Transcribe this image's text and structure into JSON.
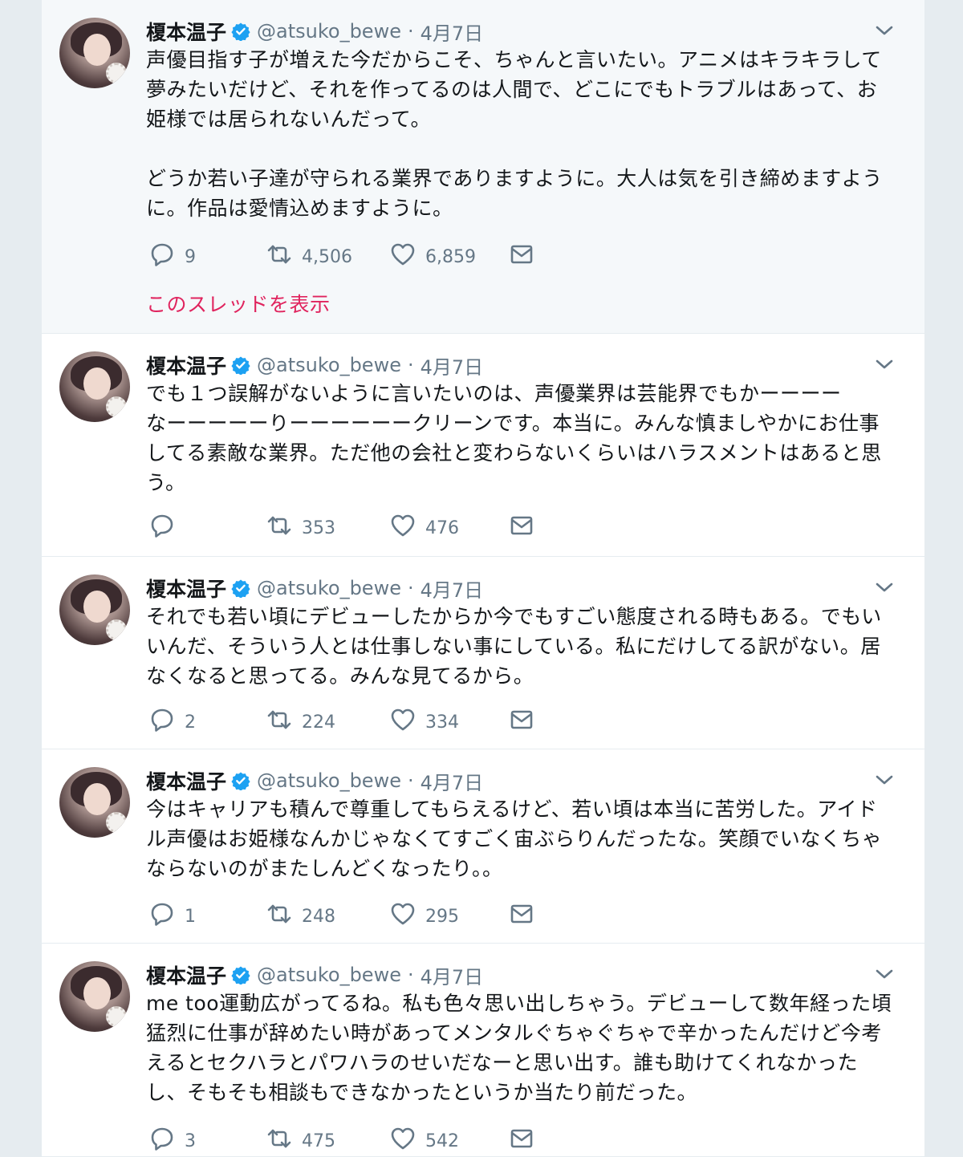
{
  "tweets": [
    {
      "name": "榎本温子",
      "handle": "@atsuko_bewe",
      "separator": "·",
      "date": "4月7日",
      "text": "声優目指す子が増えた今だからこそ、ちゃんと言いたい。アニメはキラキラして\n夢みたいだけど、それを作ってるのは人間で、どこにでもトラブルはあって、お\n姫様では居られないんだって。\n\nどうか若い子達が守られる業界でありますように。大人は気を引き締めますよう\nに。作品は愛情込めますように。",
      "replies": "9",
      "retweets": "4,506",
      "likes": "6,859",
      "thread_link": "このスレッドを表示"
    },
    {
      "name": "榎本温子",
      "handle": "@atsuko_bewe",
      "separator": "·",
      "date": "4月7日",
      "text": "でも１つ誤解がないように言いたいのは、声優業界は芸能界でもかーーーー\nなーーーーーりーーーーーークリーンです。本当に。みんな慎ましやかにお仕事\nしてる素敵な業界。ただ他の会社と変わらないくらいはハラスメントはあると思\nう。",
      "replies": "",
      "retweets": "353",
      "likes": "476"
    },
    {
      "name": "榎本温子",
      "handle": "@atsuko_bewe",
      "separator": "·",
      "date": "4月7日",
      "text": "それでも若い頃にデビューしたからか今でもすごい態度される時もある。でもい\nいんだ、そういう人とは仕事しない事にしている。私にだけしてる訳がない。居\nなくなると思ってる。みんな見てるから。",
      "replies": "2",
      "retweets": "224",
      "likes": "334"
    },
    {
      "name": "榎本温子",
      "handle": "@atsuko_bewe",
      "separator": "·",
      "date": "4月7日",
      "text": "今はキャリアも積んで尊重してもらえるけど、若い頃は本当に苦労した。アイド\nル声優はお姫様なんかじゃなくてすごく宙ぶらりんだったな。笑顔でいなくちゃ\nならないのがまたしんどくなったり。。",
      "replies": "1",
      "retweets": "248",
      "likes": "295"
    },
    {
      "name": "榎本温子",
      "handle": "@atsuko_bewe",
      "separator": "·",
      "date": "4月7日",
      "text": "me too運動広がってるね。私も色々思い出しちゃう。デビューして数年経った頃\n猛烈に仕事が辞めたい時があってメンタルぐちゃぐちゃで辛かったんだけど今考\nえるとセクハラとパワハラのせいだなーと思い出す。誰も助けてくれなかった\nし、そもそも相談もできなかったというか当たり前だった。",
      "replies": "3",
      "retweets": "475",
      "likes": "542"
    }
  ],
  "colors": {
    "verified": "#1da1f2",
    "thread_link": "#e0245e",
    "meta_gray": "#657786",
    "text": "#14171a",
    "background": "#e6ecf0"
  },
  "icons": {
    "verified": "verified-badge-icon",
    "caret": "chevron-down-icon",
    "reply": "reply-icon",
    "retweet": "retweet-icon",
    "like": "heart-icon",
    "dm": "envelope-icon"
  }
}
